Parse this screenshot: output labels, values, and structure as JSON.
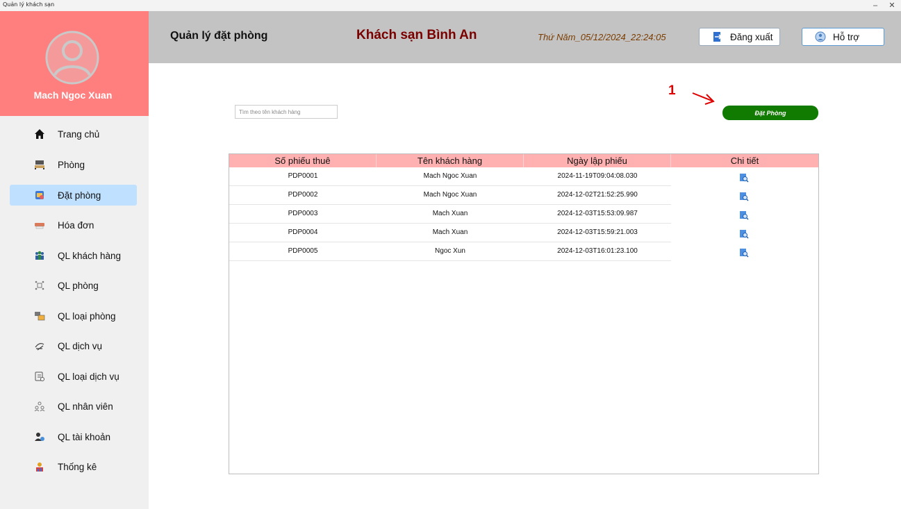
{
  "window": {
    "title": "Quản lý khách sạn",
    "minimize": "–",
    "close": "✕"
  },
  "profile": {
    "name": "Mach Ngoc Xuan",
    "avatar_icon": "user-avatar-icon"
  },
  "sidebar": {
    "items": [
      {
        "label": "Trang chủ",
        "icon": "home-icon",
        "active": false
      },
      {
        "label": "Phòng",
        "icon": "room-icon",
        "active": false
      },
      {
        "label": "Đặt phòng",
        "icon": "booking-icon",
        "active": true
      },
      {
        "label": "Hóa đơn",
        "icon": "invoice-icon",
        "active": false
      },
      {
        "label": "QL khách hàng",
        "icon": "customers-icon",
        "active": false
      },
      {
        "label": "QL phòng",
        "icon": "room-manage-icon",
        "active": false
      },
      {
        "label": "QL loại phòng",
        "icon": "room-type-icon",
        "active": false
      },
      {
        "label": "QL dịch vụ",
        "icon": "service-icon",
        "active": false
      },
      {
        "label": "QL loại dịch vụ",
        "icon": "service-type-icon",
        "active": false
      },
      {
        "label": "QL nhân viên",
        "icon": "staff-icon",
        "active": false
      },
      {
        "label": "QL tài khoản",
        "icon": "account-icon",
        "active": false
      },
      {
        "label": "Thống kê",
        "icon": "statistics-icon",
        "active": false
      }
    ]
  },
  "header": {
    "page_title": "Quản lý đặt phòng",
    "hotel_name": "Khách sạn Bình An",
    "datetime": "Thứ Năm_05/12/2024_22:24:05",
    "logout_label": "Đăng xuất",
    "help_label": "Hỗ trợ"
  },
  "content": {
    "annotation": "1",
    "book_button": "Đặt Phòng",
    "search_placeholder": "Tìm theo tên khách hàng",
    "table": {
      "headers": [
        "Số phiếu thuê",
        "Tên khách hàng",
        "Ngày lập phiếu",
        "Chi tiết"
      ],
      "rows": [
        [
          "PDP0001",
          "Mach Ngoc Xuan",
          "2024-11-19T09:04:08.030"
        ],
        [
          "PDP0002",
          "Mach Ngoc Xuan",
          "2024-12-02T21:52:25.990"
        ],
        [
          "PDP0003",
          "Mach Xuan",
          "2024-12-03T15:53:09.987"
        ],
        [
          "PDP0004",
          "Mach Xuan",
          "2024-12-03T15:59:21.003"
        ],
        [
          "PDP0005",
          "Ngoc Xun",
          "2024-12-03T16:01:23.100"
        ]
      ]
    }
  },
  "colors": {
    "profile_bg": "#ff7f7f",
    "header_bg": "#c3c3c3",
    "hotel_name": "#7a0000",
    "table_header_bg": "#ffb0b0",
    "book_button_bg": "#117a00",
    "active_nav_bg": "#bfe0ff",
    "annotation": "#e00000"
  }
}
